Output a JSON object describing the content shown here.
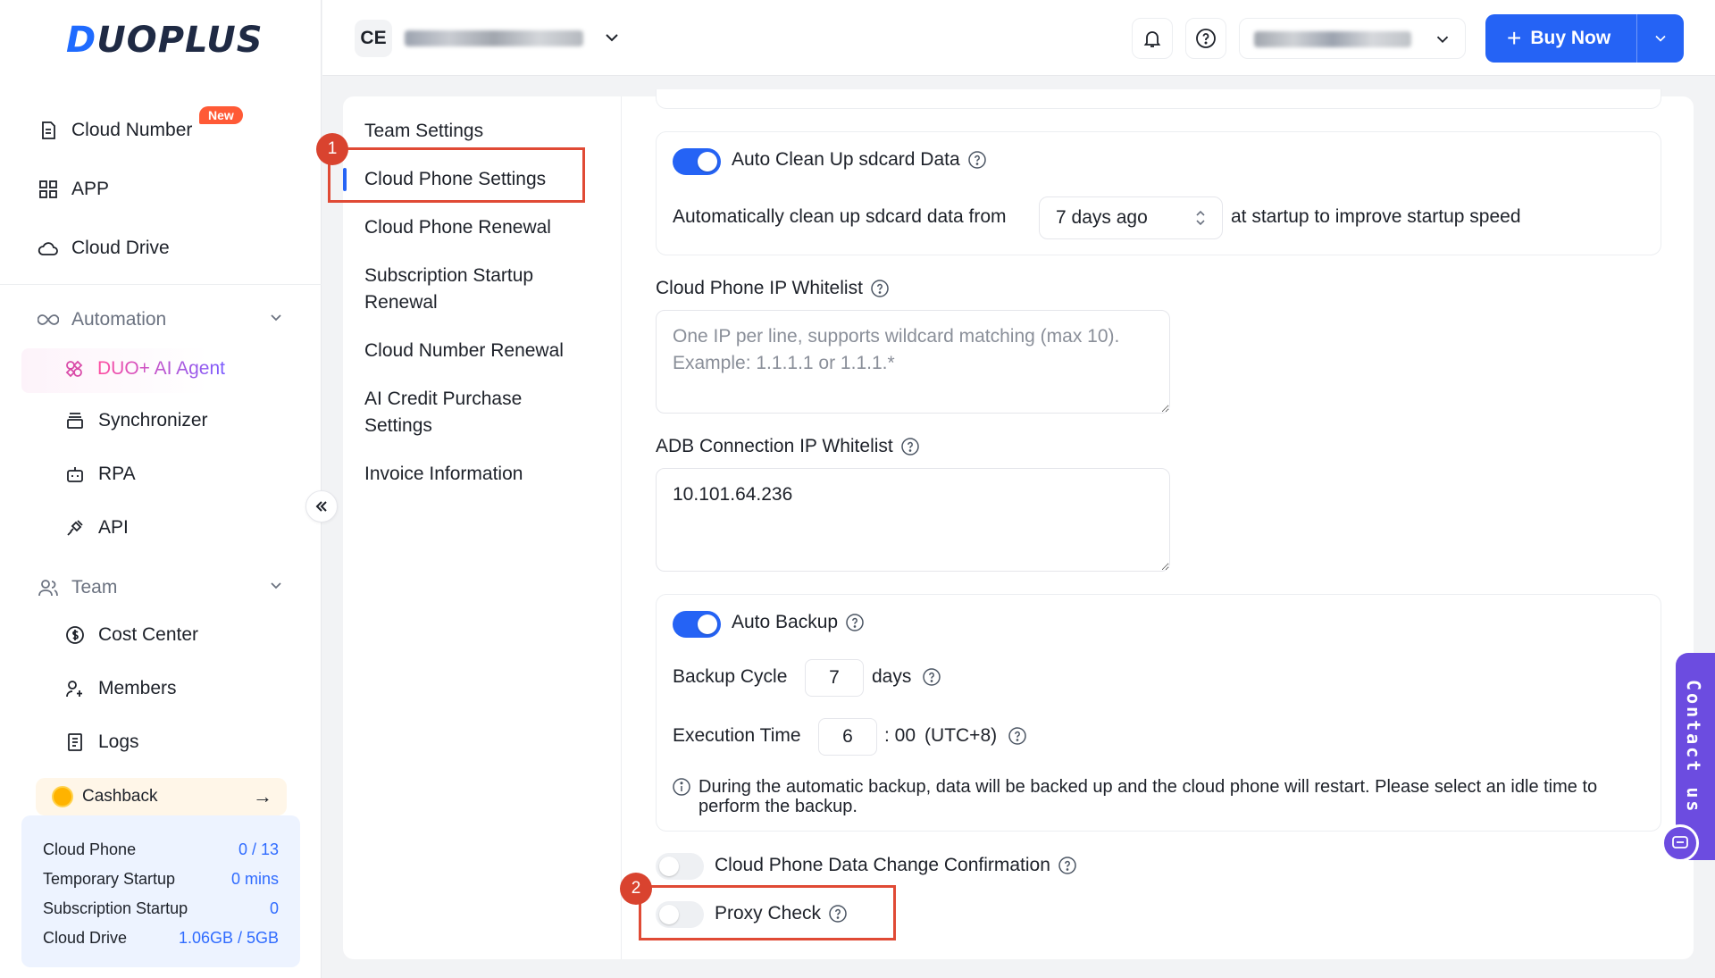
{
  "brand": {
    "logo_text_a": "D",
    "logo_text_b": "UOPLUS"
  },
  "sidebar": {
    "cloud_number": "Cloud Number",
    "new_badge": "New",
    "app": "APP",
    "cloud_drive": "Cloud Drive",
    "automation": "Automation",
    "ai_agent": "DUO+ AI Agent",
    "synchronizer": "Synchronizer",
    "rpa": "RPA",
    "api": "API",
    "team": "Team",
    "cost_center": "Cost Center",
    "members": "Members",
    "logs": "Logs",
    "cashback": "Cashback",
    "usage": [
      {
        "label": "Cloud Phone",
        "value": "0 / 13"
      },
      {
        "label": "Temporary Startup",
        "value": "0 mins"
      },
      {
        "label": "Subscription Startup",
        "value": "0"
      },
      {
        "label": "Cloud Drive",
        "value": "1.06GB / 5GB"
      }
    ]
  },
  "topbar": {
    "team_initials": "CE",
    "buy_now": "Buy Now"
  },
  "settings_nav": {
    "items": [
      "Team Settings",
      "Cloud Phone Settings",
      "Cloud Phone Renewal",
      "Subscription Startup Renewal",
      "Cloud Number Renewal",
      "AI Credit Purchase Settings",
      "Invoice Information"
    ],
    "active": "Cloud Phone Settings"
  },
  "annotations": {
    "step1": "1",
    "step2": "2"
  },
  "settings": {
    "auto_clean": {
      "label": "Auto Clean Up sdcard Data",
      "enabled": true,
      "prefix": "Automatically clean up sdcard data from",
      "select_value": "7 days ago",
      "suffix": "at startup to improve startup speed"
    },
    "ip_whitelist": {
      "label": "Cloud Phone IP Whitelist",
      "value": "",
      "placeholder": "One IP per line, supports wildcard matching (max 10). Example: 1.1.1.1 or 1.1.1.*"
    },
    "adb_whitelist": {
      "label": "ADB Connection IP Whitelist",
      "value": "10.101.64.236"
    },
    "auto_backup": {
      "label": "Auto Backup",
      "enabled": true,
      "cycle_label": "Backup Cycle",
      "cycle_value": "7",
      "cycle_unit": "days",
      "exec_label": "Execution Time",
      "exec_value": "6",
      "exec_suffix": ": 00",
      "exec_tz": "(UTC+8)",
      "note": "During the automatic backup, data will be backed up and the cloud phone will restart. Please select an idle time to perform the backup."
    },
    "data_change": {
      "label": "Cloud Phone Data Change Confirmation",
      "enabled": false
    },
    "proxy_check": {
      "label": "Proxy Check",
      "enabled": false
    }
  },
  "contact": {
    "label": "Contact us"
  },
  "colors": {
    "primary": "#2563f5",
    "annotation": "#e04a35",
    "contact": "#6c4ce0"
  }
}
